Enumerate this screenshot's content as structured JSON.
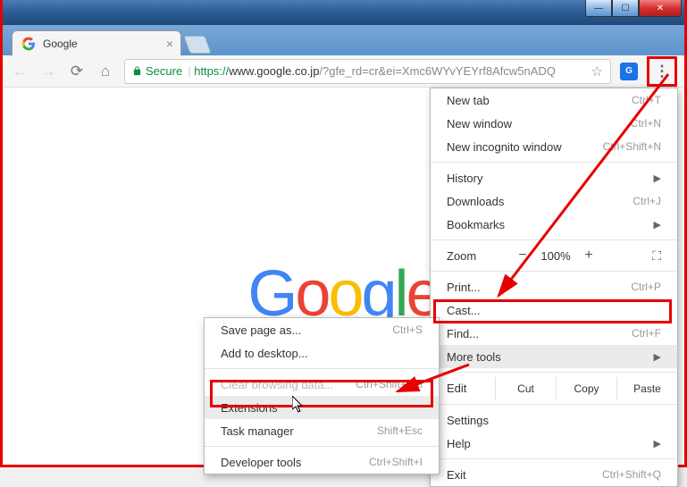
{
  "window": {
    "controls": {
      "min": "—",
      "max": "☐",
      "close": "✕"
    }
  },
  "tab": {
    "title": "Google",
    "close": "×"
  },
  "toolbar": {
    "secure_label": "Secure",
    "url_scheme": "https://",
    "url_host": "www.google.co.jp",
    "url_path": "/?gfe_rd=cr&ei=Xmc6WYvYEYrf8Afcw5nADQ",
    "ext_badge": "G",
    "menu_glyph": "⋮"
  },
  "logo": {
    "g1": "G",
    "g2": "o",
    "g3": "o",
    "g4": "g",
    "g5": "l",
    "g6": "e"
  },
  "mainmenu": {
    "newtab": {
      "label": "New tab",
      "shortcut": "Ctrl+T"
    },
    "newwindow": {
      "label": "New window",
      "shortcut": "Ctrl+N"
    },
    "incognito": {
      "label": "New incognito window",
      "shortcut": "Ctrl+Shift+N"
    },
    "history": {
      "label": "History"
    },
    "downloads": {
      "label": "Downloads",
      "shortcut": "Ctrl+J"
    },
    "bookmarks": {
      "label": "Bookmarks"
    },
    "zoom": {
      "label": "Zoom",
      "minus": "−",
      "value": "100%",
      "plus": "+",
      "fs": "⛶"
    },
    "print": {
      "label": "Print...",
      "shortcut": "Ctrl+P"
    },
    "cast": {
      "label": "Cast..."
    },
    "find": {
      "label": "Find...",
      "shortcut": "Ctrl+F"
    },
    "moretools": {
      "label": "More tools"
    },
    "edit": {
      "label": "Edit",
      "cut": "Cut",
      "copy": "Copy",
      "paste": "Paste"
    },
    "settings": {
      "label": "Settings"
    },
    "help": {
      "label": "Help"
    },
    "exit": {
      "label": "Exit",
      "shortcut": "Ctrl+Shift+Q"
    }
  },
  "submenu": {
    "savepage": {
      "label": "Save page as...",
      "shortcut": "Ctrl+S"
    },
    "adddesktop": {
      "label": "Add to desktop..."
    },
    "clearbrowsing": {
      "label": "Clear browsing data...",
      "shortcut": "Ctrl+Shift+Del"
    },
    "extensions": {
      "label": "Extensions"
    },
    "taskmanager": {
      "label": "Task manager",
      "shortcut": "Shift+Esc"
    },
    "devtools": {
      "label": "Developer tools",
      "shortcut": "Ctrl+Shift+I"
    }
  }
}
